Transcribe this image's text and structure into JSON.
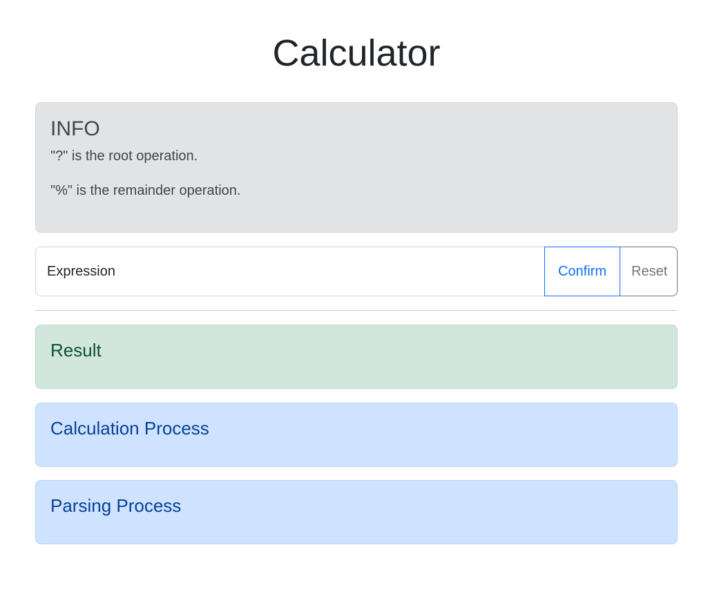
{
  "page": {
    "title": "Calculator"
  },
  "info": {
    "heading": "INFO",
    "lines": [
      "\"?\" is the root operation.",
      "\"%\" is the remainder operation."
    ]
  },
  "expression": {
    "placeholder": "Expression",
    "value": ""
  },
  "buttons": {
    "confirm": "Confirm",
    "reset": "Reset"
  },
  "panels": {
    "result": "Result",
    "calculation": "Calculation Process",
    "parsing": "Parsing Process"
  },
  "colors": {
    "primary": "#0d6efd",
    "secondary": "#6c757d",
    "info_bg": "#e2e3e5",
    "success_bg": "#d1e7dd",
    "primary_bg": "#cfe2ff"
  }
}
